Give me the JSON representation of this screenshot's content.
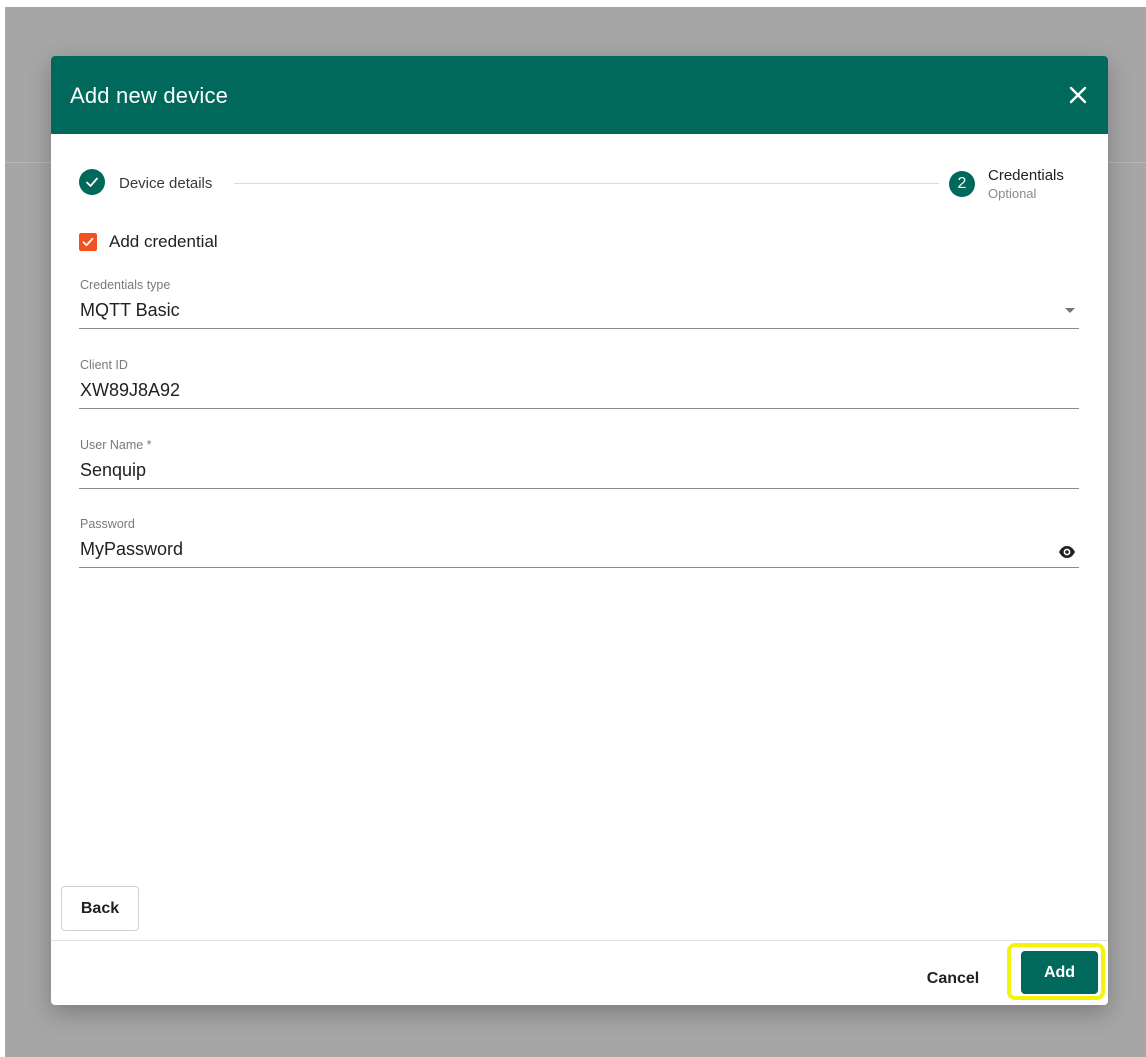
{
  "dialog": {
    "title": "Add new device",
    "colors": {
      "primary": "#00695c",
      "checkbox": "#f4511e",
      "highlight": "#f4f40a"
    }
  },
  "stepper": {
    "steps": [
      {
        "label": "Device details",
        "status": "completed",
        "icon": "check-icon"
      },
      {
        "number": "2",
        "label": "Credentials",
        "sublabel": "Optional",
        "status": "active"
      }
    ]
  },
  "checkbox": {
    "label": "Add credential",
    "checked": true
  },
  "fields": [
    {
      "label": "Credentials type",
      "value": "MQTT Basic",
      "type": "select"
    },
    {
      "label": "Client ID",
      "value": "XW89J8A92",
      "type": "text"
    },
    {
      "label": "User Name *",
      "value": "Senquip",
      "type": "text"
    },
    {
      "label": "Password",
      "value": "MyPassword",
      "type": "password",
      "icon": "eye-icon"
    }
  ],
  "buttons": {
    "back": "Back",
    "cancel": "Cancel",
    "add": "Add"
  }
}
